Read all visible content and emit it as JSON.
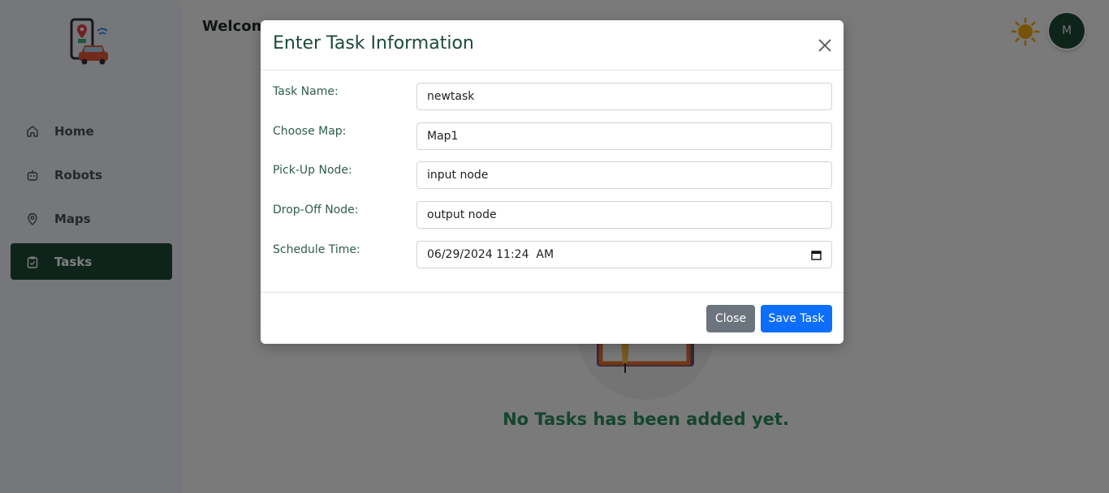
{
  "main": {
    "welcome": "Welcome",
    "avatar_initial": "M",
    "empty_message": "No Tasks has been added yet."
  },
  "sidebar": {
    "items": [
      {
        "label": "Home",
        "icon": "home-icon",
        "active": false
      },
      {
        "label": "Robots",
        "icon": "robot-icon",
        "active": false
      },
      {
        "label": "Maps",
        "icon": "map-pin-icon",
        "active": false
      },
      {
        "label": "Tasks",
        "icon": "clipboard-check-icon",
        "active": true
      }
    ]
  },
  "modal": {
    "title": "Enter Task Information",
    "fields": [
      {
        "label": "Task Name:",
        "value": "newtask"
      },
      {
        "label": "Choose Map:",
        "value": "Map1"
      },
      {
        "label": "Pick-Up Node:",
        "value": "input node"
      },
      {
        "label": "Drop-Off Node:",
        "value": "output node"
      },
      {
        "label": "Schedule Time:",
        "value": "06/29/2024 11:24  AM"
      }
    ],
    "close_label": "Close",
    "save_label": "Save Task"
  },
  "colors": {
    "brand_dark_green": "#1c4836",
    "accent_green": "#2d8a5f",
    "primary_blue": "#0d6efd",
    "secondary_gray": "#6c757d",
    "sun_orange": "#f0a412"
  }
}
